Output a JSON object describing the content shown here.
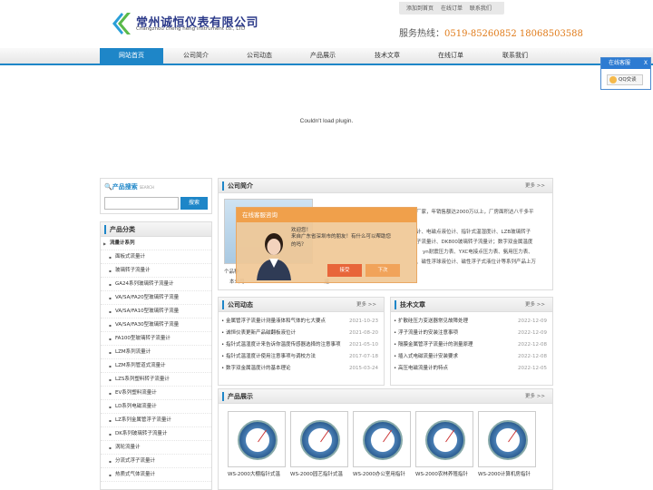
{
  "header": {
    "company_cn": "常州诚恒仪表有限公司",
    "company_en": "Changzhou cheng heng instrument co., LTD",
    "toplinks": [
      "添加到首页",
      "在线订单",
      "联系我们"
    ],
    "hotline_label": "服务热线：",
    "hotline_numbers": "0519-85260852  18068503588"
  },
  "nav": {
    "items": [
      "网站首页",
      "公司简介",
      "公司动态",
      "产品展示",
      "技术文章",
      "在线订单",
      "联系我们"
    ],
    "active_index": 0
  },
  "plugin": {
    "message": "Couldn't load plugin."
  },
  "search": {
    "title": "产品搜索",
    "subtitle": "SEARCH",
    "placeholder": "",
    "button": "搜索"
  },
  "categories": {
    "title": "产品分类",
    "items": [
      "流量计系列",
      "面板式流量计",
      "玻璃转子流量计",
      "GA24系列玻璃转子流量计",
      "VA/SA/FA20型玻璃转子流量",
      "VA/SA/FA10型玻璃转子流量",
      "VA/SA/FA30型玻璃转子流量",
      "FA100型玻璃转子流量计",
      "LZM系列流量计",
      "LZM系列管道式流量计",
      "LZS系列塑料转子流量计",
      "EV系列塑料流量计",
      "LD系列电磁流量计",
      "LZ系列金属管浮子流量计",
      "DK系列玻璃转子流量计",
      "涡轮流量计",
      "分流式浮子流量计",
      "热质式气体流量计"
    ]
  },
  "about": {
    "title": "公司简介",
    "more": "更多 >>",
    "lines": [
      "厂家，年销售额达2000万以上，厂房面积达八千多平",
      "计、电磁点液位计、指针式温湿度计、LZB玻璃转子",
      "子流量计、DK800玻璃转子流量计；数字双金属温度",
      "yn耐震压力表、YXC电接点压力表、氨用压力表、",
      "、磁性浮球液位计、磁性浮子式液位计等系列产品上万",
      "个品种",
      "本公司…………………………………………建…"
    ]
  },
  "news": {
    "title": "公司动态",
    "more": "更多 >>",
    "items": [
      {
        "title": "金属管浮子流量计测量液体和气体的七大要点",
        "date": "2021-10-23"
      },
      {
        "title": "诚恒仪表更新产品磁翻板液位计",
        "date": "2021-08-20"
      },
      {
        "title": "指针式温湿度计来告诉你温度传感器选择的注意事项",
        "date": "2021-05-10"
      },
      {
        "title": "指针式温湿度计使用注意事项与调校方法",
        "date": "2017-07-18"
      },
      {
        "title": "数字双金属温度计的基本理论",
        "date": "2015-03-24"
      }
    ]
  },
  "tech": {
    "title": "技术文章",
    "more": "更多 >>",
    "items": [
      {
        "title": "扩散硅压力变送器常见故障处理",
        "date": "2022-12-09"
      },
      {
        "title": "浮子流量计的安装注意事项",
        "date": "2022-12-09"
      },
      {
        "title": "隔膜金属管浮子流量计的测量原理",
        "date": "2022-12-08"
      },
      {
        "title": "插入式电磁流量计安装要求",
        "date": "2022-12-08"
      },
      {
        "title": "高压电磁流量计的特点",
        "date": "2022-12-05"
      }
    ]
  },
  "products": {
    "title": "产品展示",
    "more": "更多 >>",
    "items": [
      "WS-2000大棚指针式温",
      "WS-2000园艺指针式温",
      "WS-2000办公室用指针",
      "WS-2000农林养殖指针",
      "WS-2000计算机房指针"
    ]
  },
  "chat": {
    "title": "在线客服咨询",
    "greeting": "欢迎您！",
    "message": "来自广东省深圳市的朋友！有什么可以帮助您的吗？",
    "accept": "接受",
    "later": "下次"
  },
  "service_float": {
    "title": "在线客服",
    "close": "X",
    "qq": "QQ交谈"
  },
  "colors": {
    "brand_blue": "#1e86c8",
    "hotline_orange": "#e07b1a",
    "chat_orange": "#f0a04b"
  }
}
